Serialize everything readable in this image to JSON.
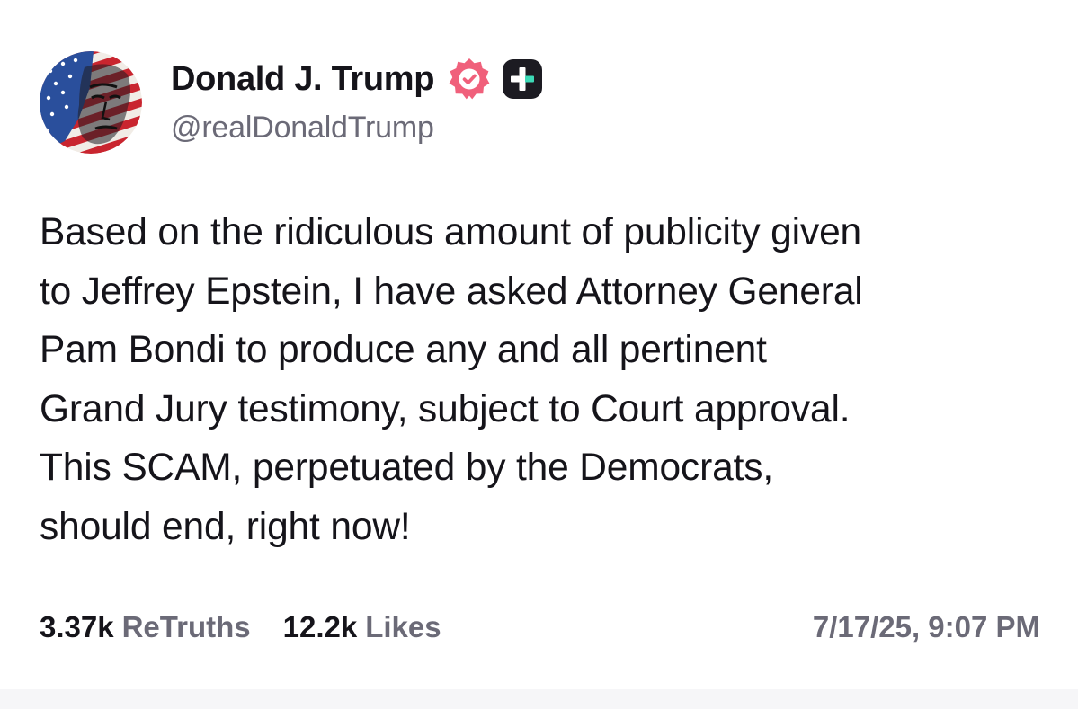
{
  "author": {
    "display_name": "Donald J. Trump",
    "handle": "@realDonaldTrump",
    "avatar_icon": "flag-portrait-avatar",
    "verified_icon": "verified-badge-icon",
    "subscription_icon": "plus-badge-icon"
  },
  "post": {
    "lines": [
      "Based on the ridiculous amount of publicity given",
      "to Jeffrey Epstein, I have asked Attorney General",
      "Pam Bondi to produce any and all pertinent",
      "Grand Jury testimony, subject to Court approval.",
      "This SCAM, perpetuated by the Democrats,",
      "should end, right now!"
    ]
  },
  "stats": {
    "retruths_count": "3.37k",
    "retruths_label": "ReTruths",
    "likes_count": "12.2k",
    "likes_label": "Likes",
    "timestamp": "7/17/25, 9:07 PM"
  },
  "colors": {
    "text_primary": "#15141a",
    "text_secondary": "#6b6a77",
    "verified_badge": "#f0607b",
    "plus_badge": "#1c1b22",
    "plus_accent": "#3ddab7"
  }
}
